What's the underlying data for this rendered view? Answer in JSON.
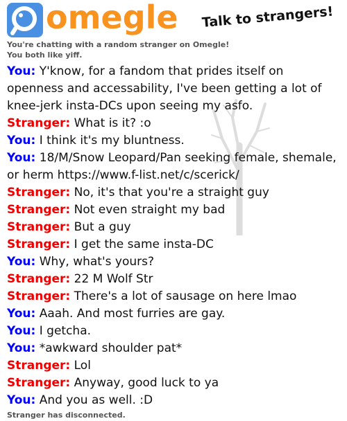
{
  "header": {
    "logo_text": "omegle",
    "tagline": "Talk to strangers!"
  },
  "notices": {
    "chatting": "You're chatting with a random stranger on Omegle!",
    "interests": "You both like yiff."
  },
  "labels": {
    "you": "You:",
    "stranger": "Stranger:"
  },
  "messages": [
    {
      "speaker": "you",
      "text": "Y'know, for a fandom that prides itself on openness and accessability, I've been getting a lot of knee-jerk insta-DCs upon seeing my asfo."
    },
    {
      "speaker": "stranger",
      "text": "What is it? :o"
    },
    {
      "speaker": "you",
      "text": "I think it's my bluntness."
    },
    {
      "speaker": "you",
      "text": "18/M/Snow Leopard/Pan seeking female, shemale, or herm https://www.f-list.net/c/scerick/"
    },
    {
      "speaker": "stranger",
      "text": "No, it's that you're a straight guy"
    },
    {
      "speaker": "stranger",
      "text": "Not even straight my bad"
    },
    {
      "speaker": "stranger",
      "text": "But a guy"
    },
    {
      "speaker": "stranger",
      "text": "I get the same insta-DC"
    },
    {
      "speaker": "you",
      "text": "Why, what's yours?"
    },
    {
      "speaker": "stranger",
      "text": "22 M Wolf Str"
    },
    {
      "speaker": "stranger",
      "text": "There's a lot of sausage on here lmao"
    },
    {
      "speaker": "you",
      "text": "Aaah. And most furries are gay."
    },
    {
      "speaker": "you",
      "text": "I getcha."
    },
    {
      "speaker": "you",
      "text": "*awkward shoulder pat*"
    },
    {
      "speaker": "stranger",
      "text": "Lol"
    },
    {
      "speaker": "stranger",
      "text": "Anyway, good luck to ya"
    },
    {
      "speaker": "you",
      "text": "And you as well. :D"
    }
  ],
  "status": {
    "disconnected": "Stranger has disconnected."
  },
  "colors": {
    "you": "#0000ff",
    "stranger": "#ee0000",
    "logo_orange": "#f7931e",
    "logo_blue": "#4a90e2"
  }
}
